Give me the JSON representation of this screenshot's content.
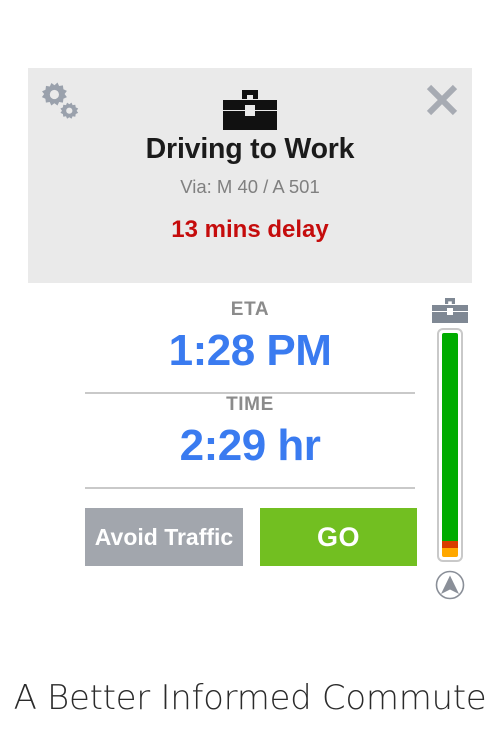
{
  "card": {
    "header": {
      "settings_icon": "gears-icon",
      "close_icon": "close-x-icon",
      "destination_icon": "briefcase-icon",
      "title": "Driving to Work",
      "via": "Via: M 40 / A 501",
      "delay": "13 mins delay",
      "delay_color": "#c50c0c",
      "background_color": "#eaeaea"
    },
    "stats": [
      {
        "label": "ETA",
        "value": "1:28 PM"
      },
      {
        "label": "TIME",
        "value": "2:29 hr"
      }
    ],
    "stat_value_color": "#3a7bf0",
    "stat_label_color": "#8b8b8b",
    "actions": {
      "avoid_traffic_label": "Avoid Traffic",
      "avoid_traffic_color": "#a2a6ad",
      "go_label": "GO",
      "go_color": "#72bf21"
    }
  },
  "traffic_gauge": {
    "destination_icon": "briefcase-icon",
    "current_position_icon": "navigation-arrow-icon",
    "segments": [
      {
        "name": "clear",
        "color": "#00ac00",
        "percent": 93
      },
      {
        "name": "heavy",
        "color": "#d93b00",
        "percent": 3
      },
      {
        "name": "moderate",
        "color": "#ffa800",
        "percent": 4
      }
    ]
  },
  "tagline": "A Better Informed Commute"
}
